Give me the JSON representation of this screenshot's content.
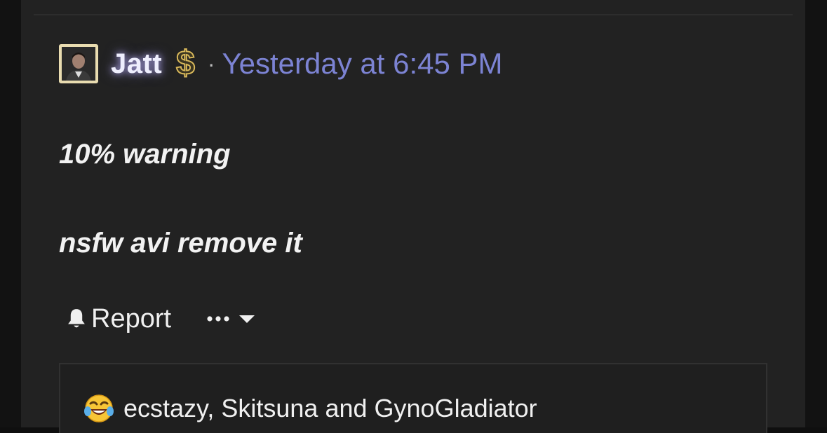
{
  "post": {
    "author": {
      "username": "Jatt",
      "badge_symbol": "$"
    },
    "separator": "·",
    "timestamp": "Yesterday at 6:45 PM",
    "lines": [
      "10% warning",
      "nsfw avi remove it"
    ]
  },
  "actions": {
    "report_label": "Report"
  },
  "reactions": {
    "emoji": "😂",
    "users_text": "ecstazy, Skitsuna and GynoGladiator"
  },
  "colors": {
    "timestamp": "#7c83d3",
    "avatar_border": "#e9dcb0",
    "badge_gold": "#d7b75a",
    "background": "#222222"
  }
}
